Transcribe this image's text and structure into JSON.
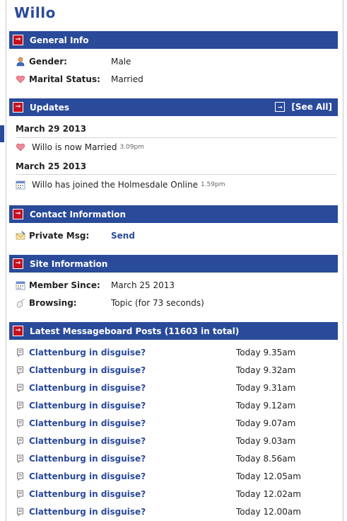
{
  "profile": {
    "name": "Willo"
  },
  "colors": {
    "header_bar": "#2a4a9a",
    "expand_button": "#c8101e",
    "link": "#2a4a9a"
  },
  "general_info": {
    "header": "General Info",
    "gender_label": "Gender:",
    "gender_value": "Male",
    "gender_icon": "person-icon",
    "marital_label": "Marital Status:",
    "marital_value": "Married",
    "marital_icon": "heart-icon"
  },
  "updates": {
    "header": "Updates",
    "see_all": "[See All]",
    "groups": [
      {
        "date": "March 29 2013",
        "text": "Willo is now Married",
        "time": "3.09pm",
        "icon": "heart-icon"
      },
      {
        "date": "March 25 2013",
        "text": "Willo has joined the Holmesdale Online",
        "time": "1.59pm",
        "icon": "calendar-icon"
      }
    ]
  },
  "contact": {
    "header": "Contact Information",
    "pm_label": "Private Msg:",
    "pm_action": "Send",
    "pm_icon": "envelope-icon"
  },
  "site_info": {
    "header": "Site Information",
    "member_label": "Member Since:",
    "member_value": "March 25 2013",
    "member_icon": "calendar-icon",
    "browsing_label": "Browsing:",
    "browsing_value": "Topic (for 73 seconds)",
    "browsing_icon": "mouse-icon"
  },
  "posts": {
    "header": "Latest Messageboard Posts (11603 in total)",
    "items": [
      {
        "title": "Clattenburg in disguise?",
        "time": "Today 9.35am"
      },
      {
        "title": "Clattenburg in disguise?",
        "time": "Today 9.32am"
      },
      {
        "title": "Clattenburg in disguise?",
        "time": "Today 9.31am"
      },
      {
        "title": "Clattenburg in disguise?",
        "time": "Today 9.12am"
      },
      {
        "title": "Clattenburg in disguise?",
        "time": "Today 9.07am"
      },
      {
        "title": "Clattenburg in disguise?",
        "time": "Today 9.03am"
      },
      {
        "title": "Clattenburg in disguise?",
        "time": "Today 8.56am"
      },
      {
        "title": "Clattenburg in disguise?",
        "time": "Today 12.05am"
      },
      {
        "title": "Clattenburg in disguise?",
        "time": "Today 12.02am"
      },
      {
        "title": "Clattenburg in disguise?",
        "time": "Today 12.00am"
      }
    ]
  }
}
